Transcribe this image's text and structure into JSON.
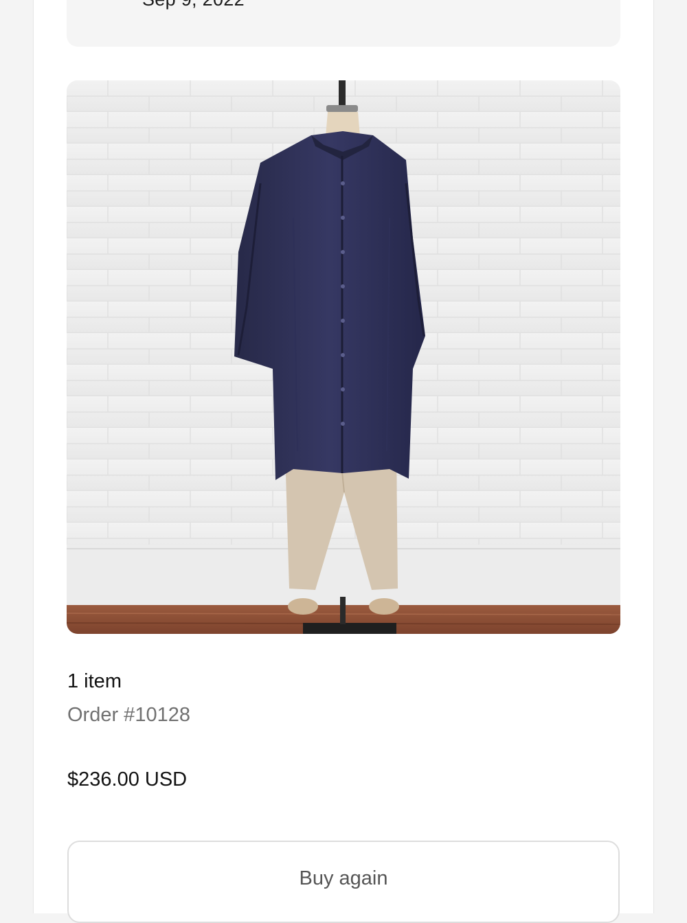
{
  "status_card": {
    "date": "Sep 9, 2022"
  },
  "order": {
    "item_count": "1 item",
    "order_number": "Order #10128",
    "total": "$236.00 USD"
  },
  "actions": {
    "buy_again_label": "Buy again"
  },
  "product": {
    "image_icon": "product-photo-tunic-on-mannequin",
    "colors": {
      "wall": "#eeeeee",
      "tunic": "#2f3158",
      "pants": "#d6c7b3",
      "floor": "#8c4e36"
    }
  }
}
